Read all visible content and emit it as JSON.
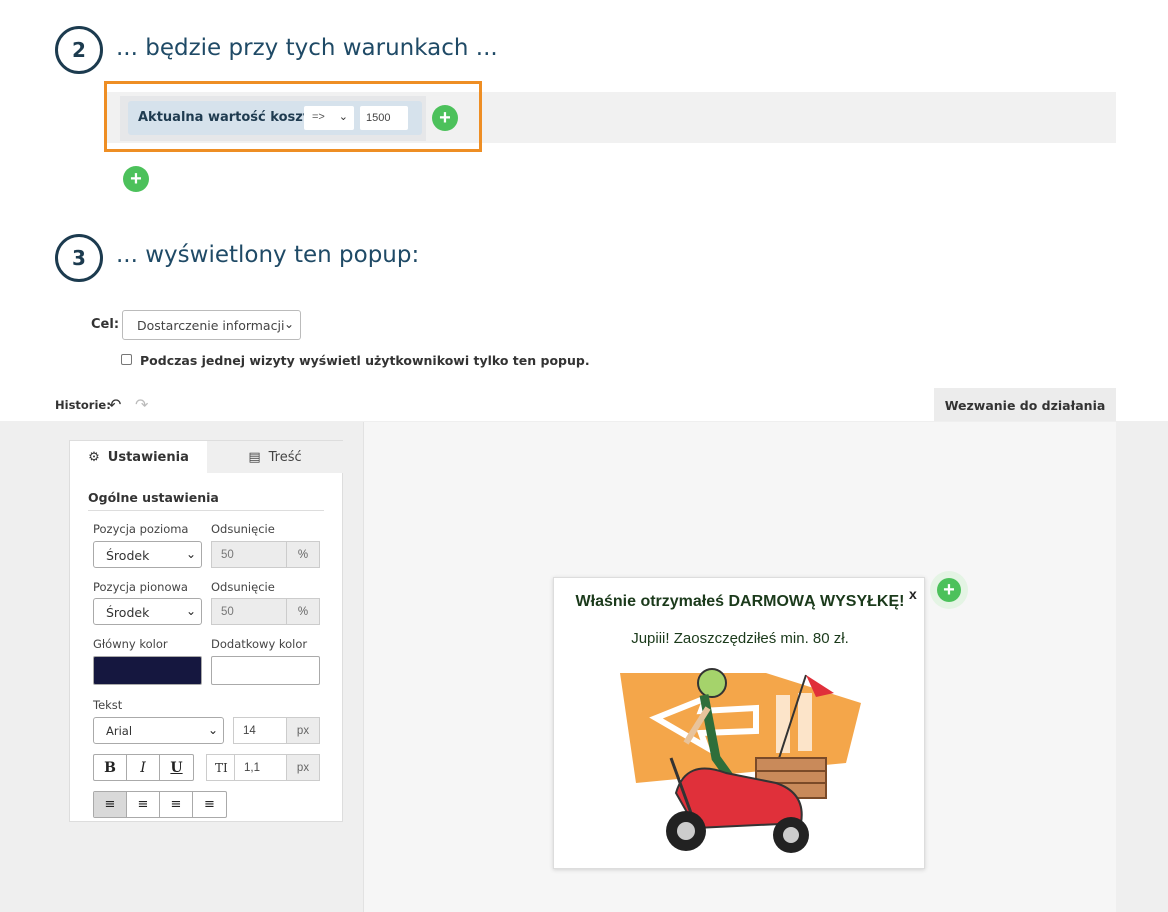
{
  "steps": {
    "step2": {
      "number": "2",
      "title": "... będzie przy tych warunkach ..."
    },
    "step3": {
      "number": "3",
      "title": "... wyświetlony ten popup:"
    }
  },
  "condition": {
    "label": "Aktualna wartość koszyka",
    "operator": "=>",
    "value": "1500",
    "highlight_color": "#ee8e24"
  },
  "icons": {
    "add": "+",
    "chevron": "⌄",
    "undo": "↶",
    "redo": "↷",
    "gear": "⚙",
    "content": "▤"
  },
  "goal": {
    "label": "Cel:",
    "selected": "Dostarczenie informacji"
  },
  "checkbox": {
    "label": "Podczas jednej wizyty wyświetl użytkownikowi tylko ten popup.",
    "checked": false
  },
  "history": {
    "label": "Historie:"
  },
  "cta_tab": {
    "label": "Wezwanie do działania"
  },
  "panel": {
    "tabs": {
      "settings": "Ustawienia",
      "content": "Treść"
    },
    "heading": "Ogólne ustawienia",
    "horizontal": {
      "label": "Pozycja pozioma",
      "value": "Środek",
      "offset_label": "Odsunięcie",
      "offset": "50",
      "unit": "%"
    },
    "vertical": {
      "label": "Pozycja pionowa",
      "value": "Środek",
      "offset_label": "Odsunięcie",
      "offset": "50",
      "unit": "%"
    },
    "main_color": {
      "label": "Główny kolor",
      "value": "#15173f"
    },
    "extra_color": {
      "label": "Dodatkowy kolor",
      "value": "#ffffff"
    },
    "text": {
      "label": "Tekst",
      "font": "Arial",
      "size": "14",
      "size_unit": "px",
      "line_height_icon": "TI",
      "line_height": "1,1",
      "line_height_unit": "px"
    },
    "format_buttons": {
      "bold": "B",
      "italic": "I",
      "underline": "U"
    },
    "align_buttons": [
      "≡",
      "≡",
      "≡",
      "≡"
    ]
  },
  "popup": {
    "title": "Właśnie otrzymałeś DARMOWĄ WYSYŁKĘ!",
    "subtitle": "Jupiii! Zaoszczędziłeś min. 80 zł.",
    "close": "x"
  },
  "colors": {
    "accent_green": "#4cc15b",
    "heading_blue": "#1f4a66",
    "scooter_red": "#e0303a",
    "arrow_orange": "#f4a64a"
  }
}
